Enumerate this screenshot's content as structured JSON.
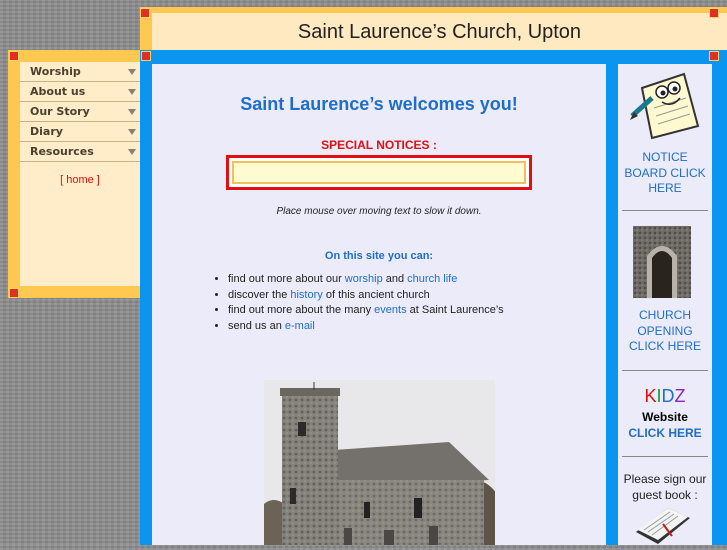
{
  "header": {
    "title": "Saint Laurence’s Church, Upton"
  },
  "sidebar": {
    "items": [
      {
        "label": "Worship"
      },
      {
        "label": "About us"
      },
      {
        "label": "Our Story"
      },
      {
        "label": "Diary"
      },
      {
        "label": "Resources"
      }
    ],
    "home_link": "[ home ]"
  },
  "main": {
    "welcome": "Saint Laurence’s welcomes you!",
    "special_notices": "SPECIAL NOTICES :",
    "marquee_note": "Place mouse over moving text to slow it down.",
    "intro": "On this site you can:",
    "bullets": [
      {
        "pre": "find out more about our ",
        "link1": "worship",
        "mid": " and ",
        "link2": "church life",
        "post": ""
      },
      {
        "pre": "discover the ",
        "link1": "history",
        "mid": " of this ancient church"
      },
      {
        "pre": "find out more about the many ",
        "link1": "events",
        "mid": " at Saint Laurence’s"
      },
      {
        "pre": "send us an ",
        "link1": "e-mail",
        "mid": ""
      }
    ]
  },
  "right": {
    "notice_board": [
      "NOTICE",
      "BOARD CLICK",
      "HERE"
    ],
    "church_opening": [
      "CHURCH",
      "OPENING",
      "CLICK HERE"
    ],
    "kidz": {
      "letters": [
        "K",
        "I",
        "D",
        "Z"
      ],
      "colors": [
        "#e01010",
        "#10a030",
        "#1e6ec8",
        "#9020c0"
      ],
      "website": "Website",
      "click": "CLICK HERE"
    },
    "guestbook": [
      "Please sign our",
      "guest book :"
    ]
  },
  "colors": {
    "accent_blue": "#0a96f0",
    "gold": "#ffc850",
    "link": "#1e6ec8",
    "red": "#e01010"
  }
}
